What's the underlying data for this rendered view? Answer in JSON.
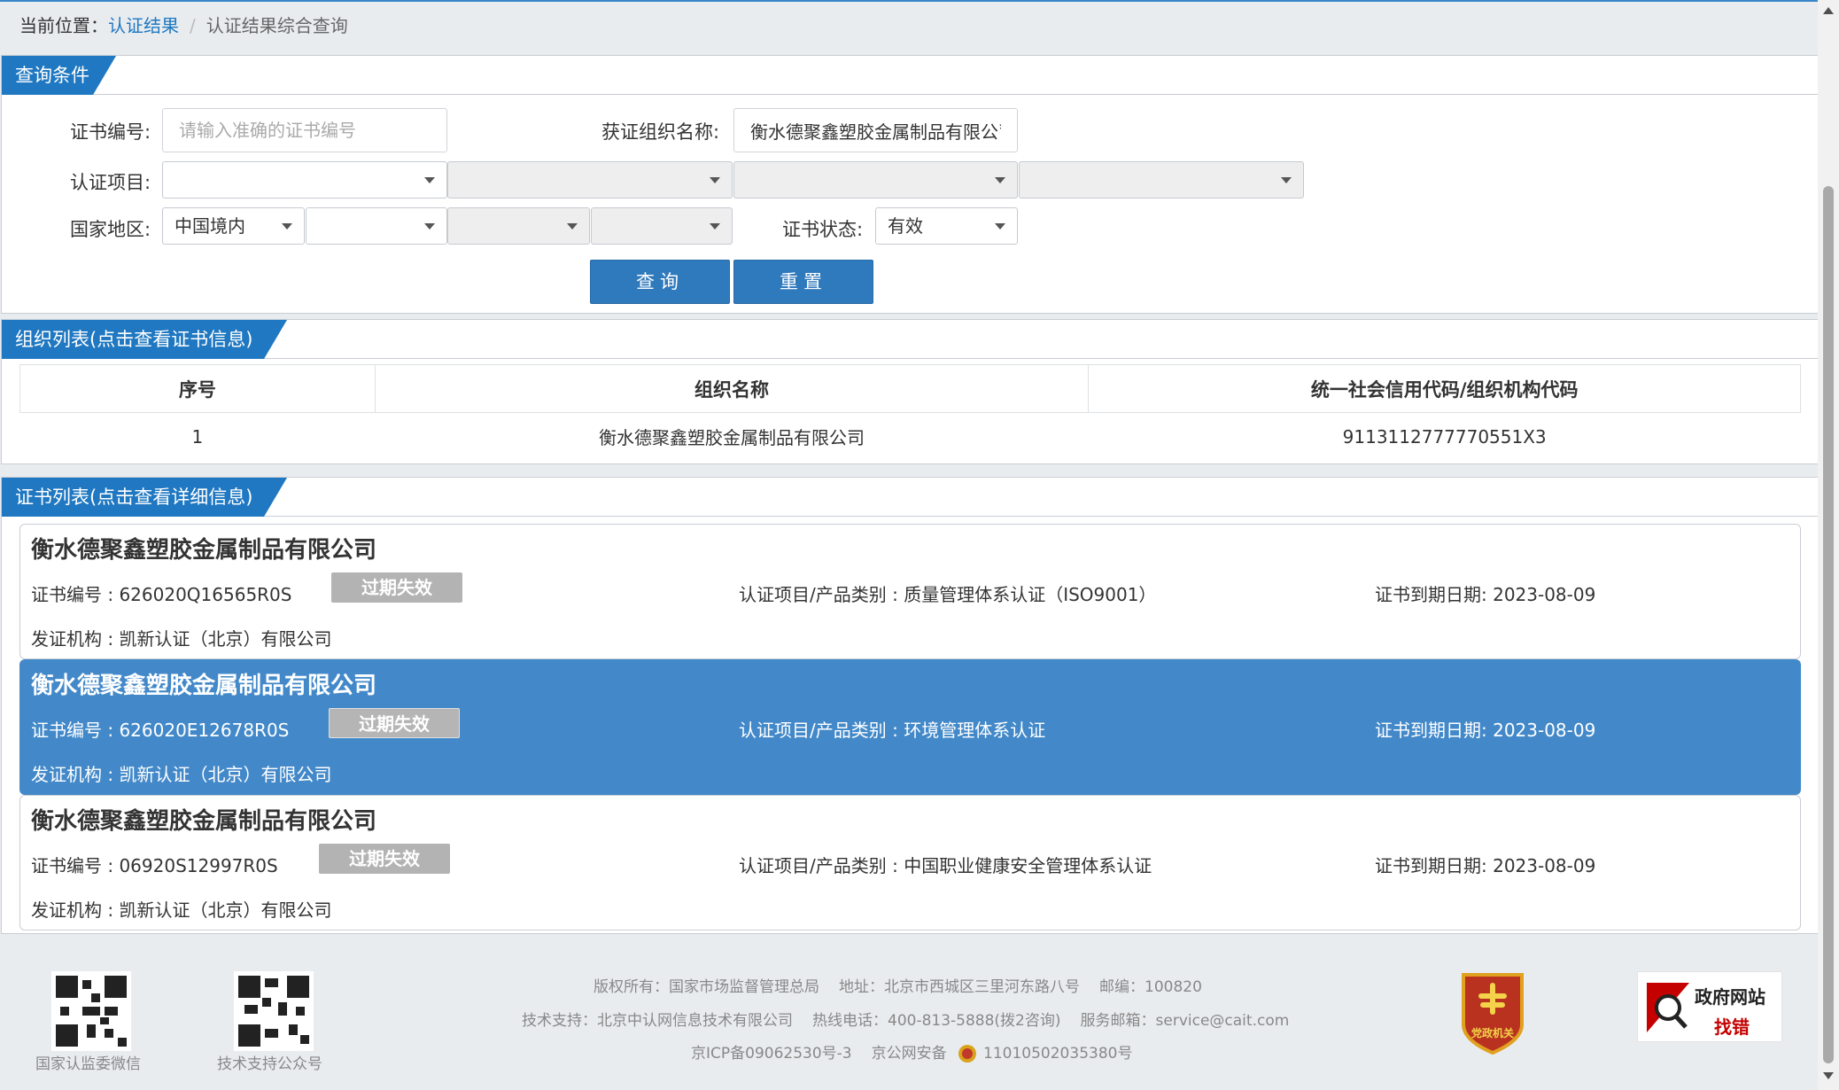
{
  "breadcrumb": {
    "prefix": "当前位置：",
    "link": "认证结果",
    "current": "认证结果综合查询"
  },
  "query": {
    "tab": "查询条件",
    "cert_no_label": "证书编号:",
    "cert_no_placeholder": "请输入准确的证书编号",
    "org_name_label": "获证组织名称:",
    "org_name_value": "衡水德聚鑫塑胶金属制品有限公司",
    "item_label": "认证项目:",
    "region_label": "国家地区:",
    "region_value": "中国境内",
    "status_label": "证书状态:",
    "status_value": "有效",
    "search_button": "查询",
    "reset_button": "重置"
  },
  "org_list": {
    "tab": "组织列表(点击查看证书信息)",
    "headers": [
      "序号",
      "组织名称",
      "统一社会信用代码/组织机构代码"
    ],
    "rows": [
      {
        "index": "1",
        "name": "衡水德聚鑫塑胶金属制品有限公司",
        "code": "9113112777770551X3"
      }
    ]
  },
  "cert_list": {
    "tab": "证书列表(点击查看详细信息)",
    "items": [
      {
        "org": "衡水德聚鑫塑胶金属制品有限公司",
        "cert_no": "证书编号 : 626020Q16565R0S",
        "status": "过期失效",
        "item": "认证项目/产品类别 : 质量管理体系认证（ISO9001）",
        "expiry": "证书到期日期: 2023-08-09",
        "issuer": "发证机构 : 凯新认证（北京）有限公司"
      },
      {
        "org": "衡水德聚鑫塑胶金属制品有限公司",
        "cert_no": "证书编号 : 626020E12678R0S",
        "status": "过期失效",
        "item": "认证项目/产品类别 : 环境管理体系认证",
        "expiry": "证书到期日期: 2023-08-09",
        "issuer": "发证机构 : 凯新认证（北京）有限公司"
      },
      {
        "org": "衡水德聚鑫塑胶金属制品有限公司",
        "cert_no": "证书编号 : 06920S12997R0S",
        "status": "过期失效",
        "item": "认证项目/产品类别 : 中国职业健康安全管理体系认证",
        "expiry": "证书到期日期: 2023-08-09",
        "issuer": "发证机构 : 凯新认证（北京）有限公司"
      }
    ]
  },
  "footer": {
    "qr1_caption": "国家认监委微信",
    "qr2_caption": "技术支持公众号",
    "copyright": "版权所有：国家市场监督管理总局",
    "address": "地址：北京市西城区三里河东路八号",
    "postcode": "邮编：100820",
    "support": "技术支持：北京中认网信息技术有限公司",
    "hotline": "热线电话：400-813-5888(拨2咨询)",
    "email": "服务邮箱：service@cait.com",
    "icp": "京ICP备09062530号-3",
    "police_prefix": "京公网安备",
    "police_no": "11010502035380号",
    "emblem_text": "党政机关",
    "err_line1": "政府网站",
    "err_line2": "找错"
  },
  "colors": {
    "brand_blue": "#1f78c1",
    "active_card": "#4389c9",
    "badge_gray": "#b3b3b3"
  }
}
